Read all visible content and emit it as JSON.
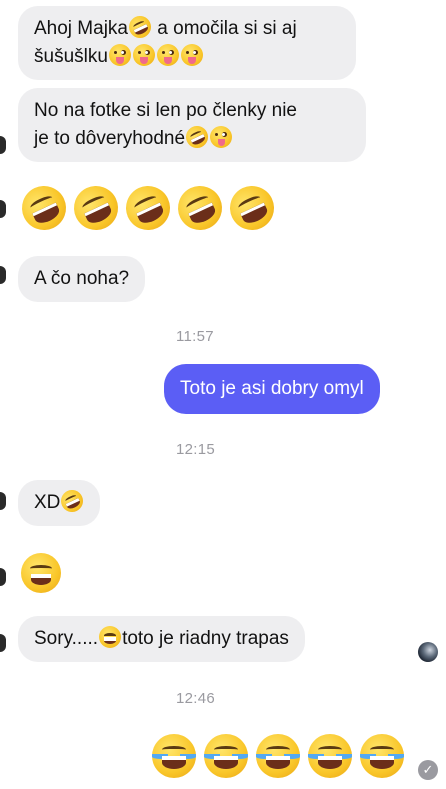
{
  "messages": {
    "m1_line1": "Ahoj Majka",
    "m1_line1b": "a omočila si si aj",
    "m1_line2": "šušušlku",
    "m2_line1": "No na fotke si len po členky nie",
    "m2_line2": "je to dôveryhodné",
    "m4": "A čo noha?",
    "t1": "11:57",
    "m5": "Toto je asi dobry omyl",
    "t2": "12:15",
    "m6": "XD",
    "m8a": "Sory.....",
    "m8b": "toto je riadny trapas",
    "t3": "12:46"
  },
  "emoji": {
    "rofl": "rolling-on-floor-laughing",
    "tongue": "zany-face",
    "joy": "face-with-tears-of-joy",
    "sweat": "grinning-face-with-sweat"
  },
  "colors": {
    "incoming_bubble": "#eeeef0",
    "outgoing_bubble": "#5b5ef5",
    "timestamp": "#9a9aa0"
  },
  "status": {
    "read_check": "✓"
  }
}
